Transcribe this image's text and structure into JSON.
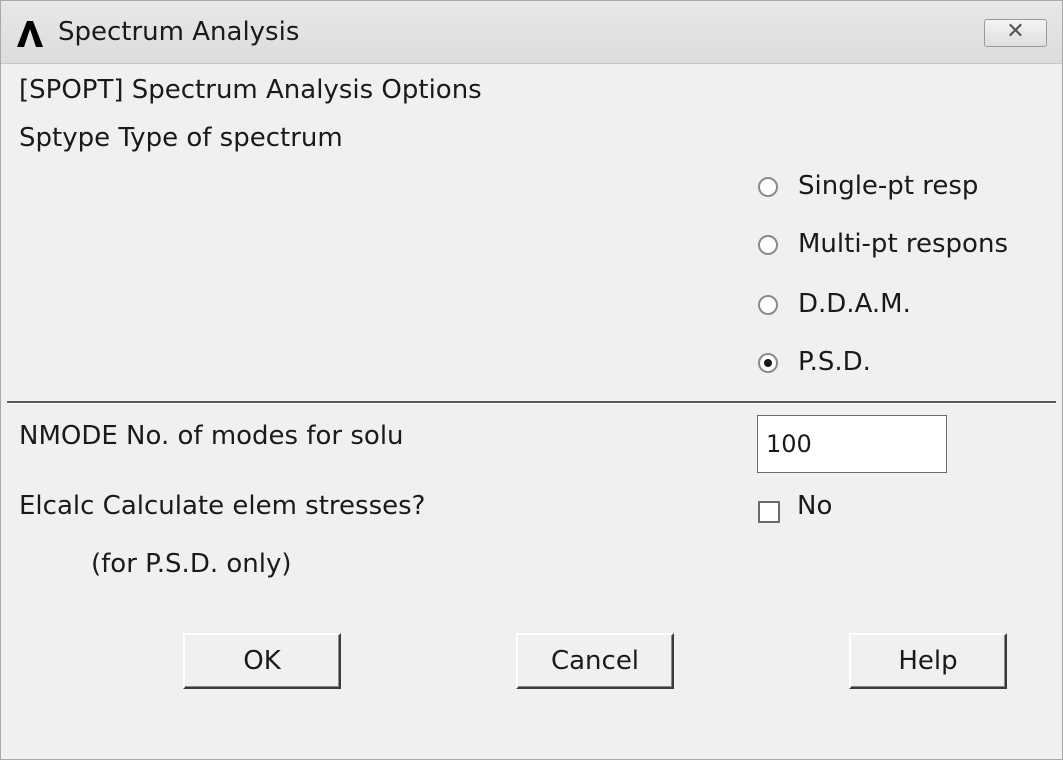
{
  "window": {
    "title": "Spectrum Analysis",
    "close_icon": "close-icon",
    "app_icon": "ansys-logo-icon"
  },
  "header": {
    "command": "[SPOPT]  Spectrum Analysis Options",
    "sptype_label": "Sptype  Type of spectrum"
  },
  "spectrum_types": [
    {
      "label": "Single-pt resp",
      "checked": false
    },
    {
      "label": "Multi-pt respons",
      "checked": false
    },
    {
      "label": "D.D.A.M.",
      "checked": false
    },
    {
      "label": "P.S.D.",
      "checked": true
    }
  ],
  "nmode": {
    "label": "NMODE   No. of modes for solu",
    "value": "100"
  },
  "elcalc": {
    "label": "Elcalc  Calculate elem stresses?",
    "note": "(for P.S.D. only)",
    "checkbox_label": "No",
    "checked": false
  },
  "buttons": {
    "ok": "OK",
    "cancel": "Cancel",
    "help": "Help"
  }
}
